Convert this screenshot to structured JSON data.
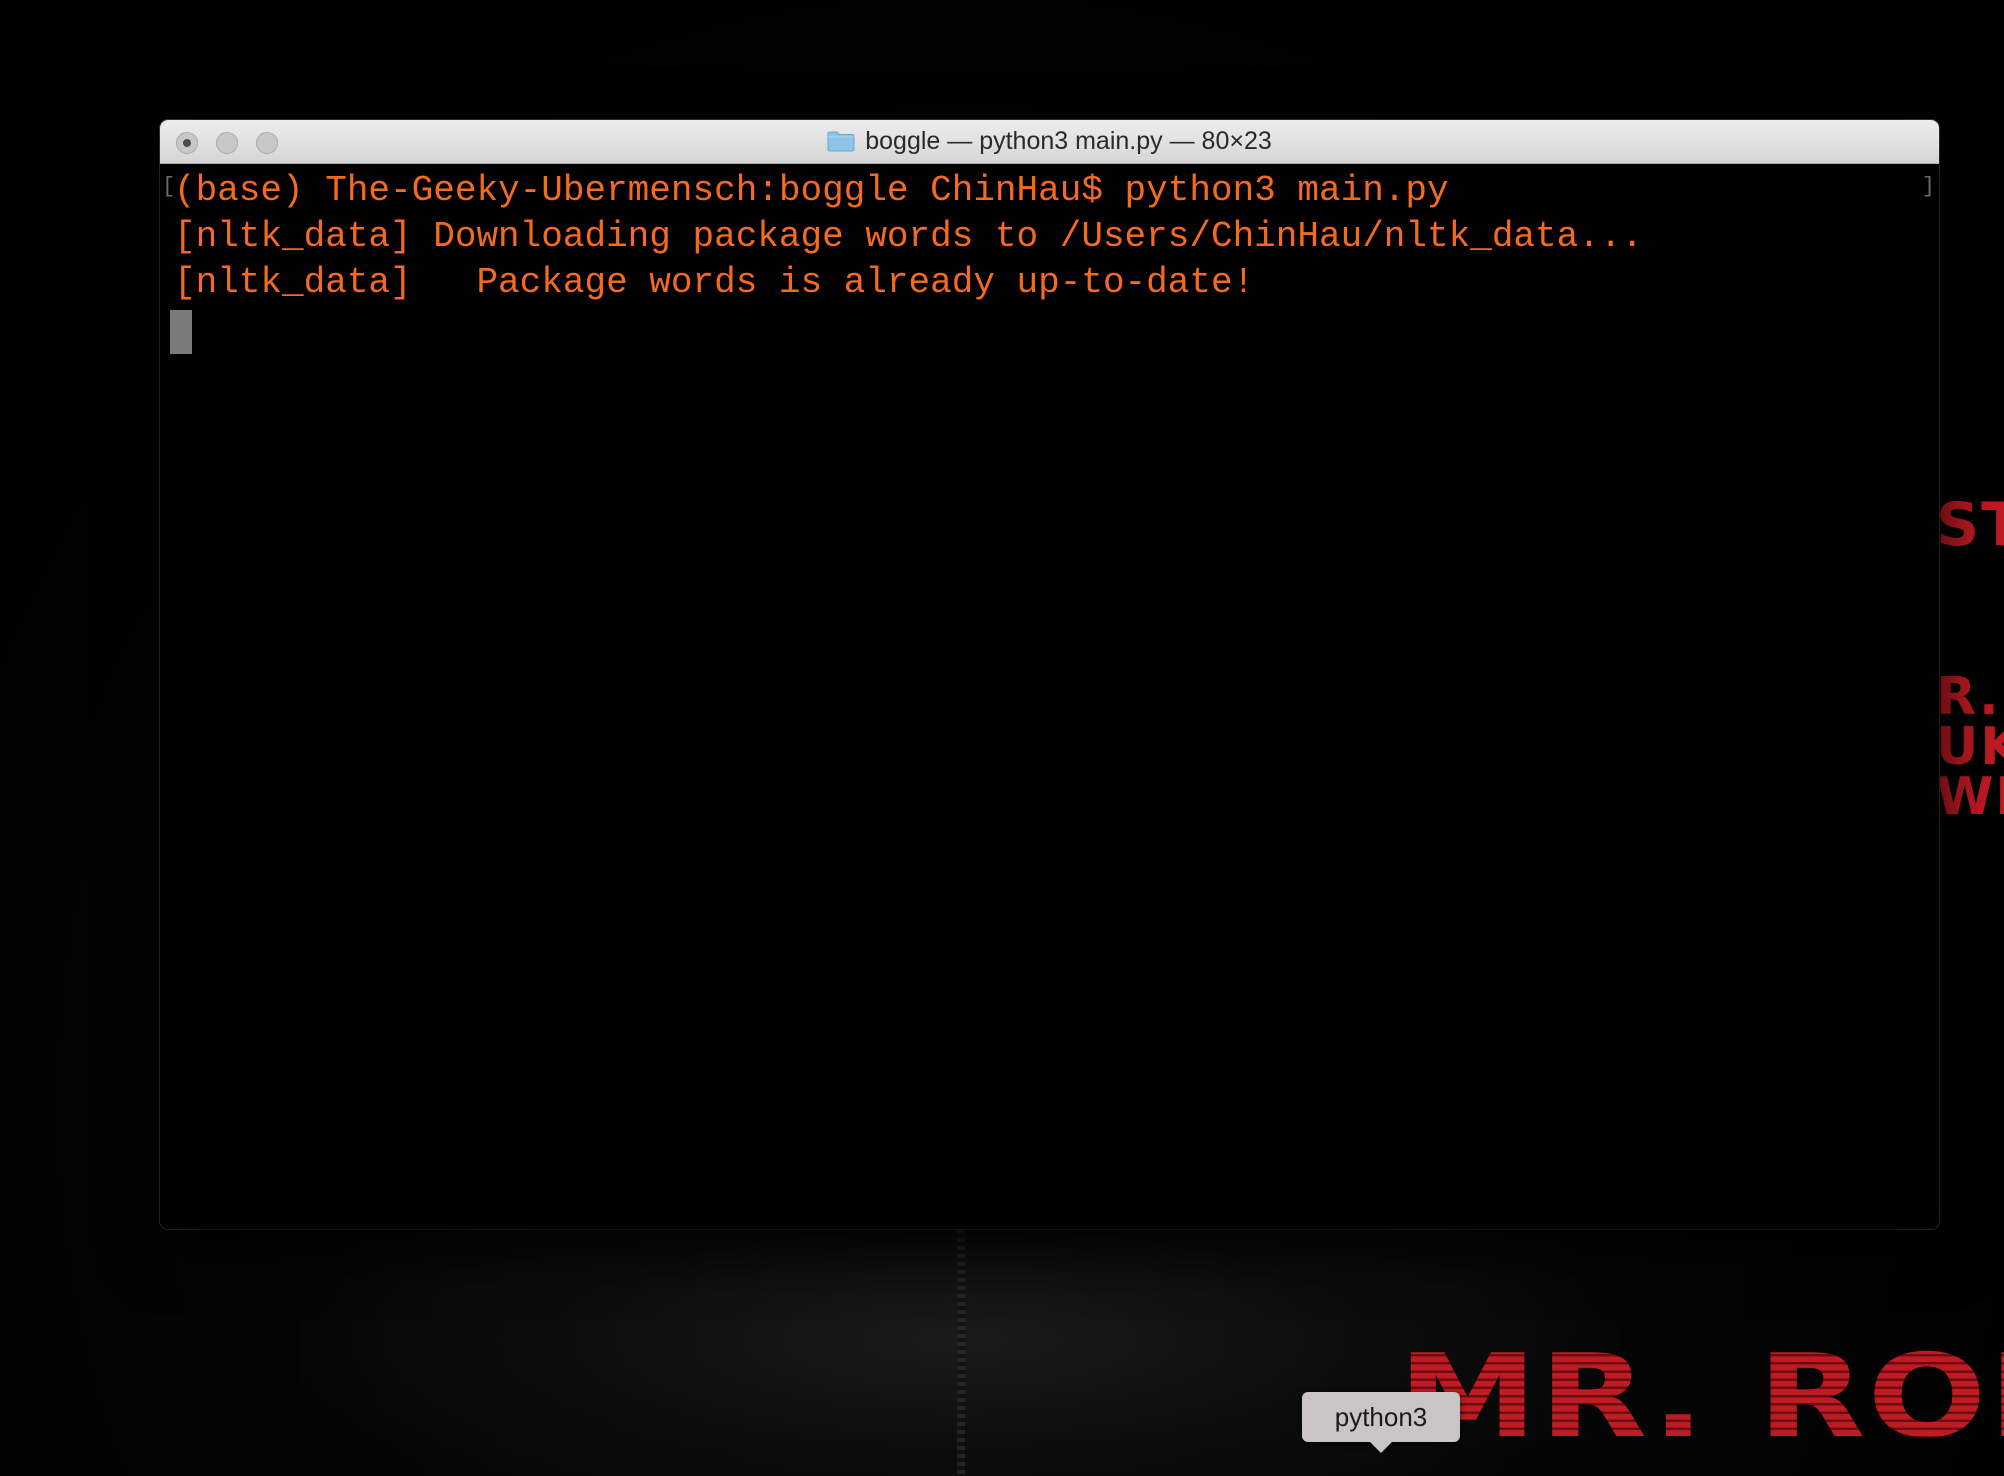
{
  "window": {
    "title": "boggle — python3 main.py — 80×23",
    "folder_icon": "folder-icon"
  },
  "terminal": {
    "lines": [
      "(base) The-Geeky-Ubermensch:boggle ChinHau$ python3 main.py",
      "[nltk_data] Downloading package words to /Users/ChinHau/nltk_data...",
      "[nltk_data]   Package words is already up-to-date!"
    ],
    "text_color": "#f46a1f",
    "background": "#000000",
    "cursor_color": "#7a7a7a"
  },
  "dock": {
    "tooltip": "python3"
  },
  "wallpaper": {
    "logo_text": "MR. ROBOT",
    "side_text_1": "ST",
    "side_text_2": [
      "R.",
      "UKI",
      "WI"
    ],
    "accent_color": "#c01a22"
  }
}
